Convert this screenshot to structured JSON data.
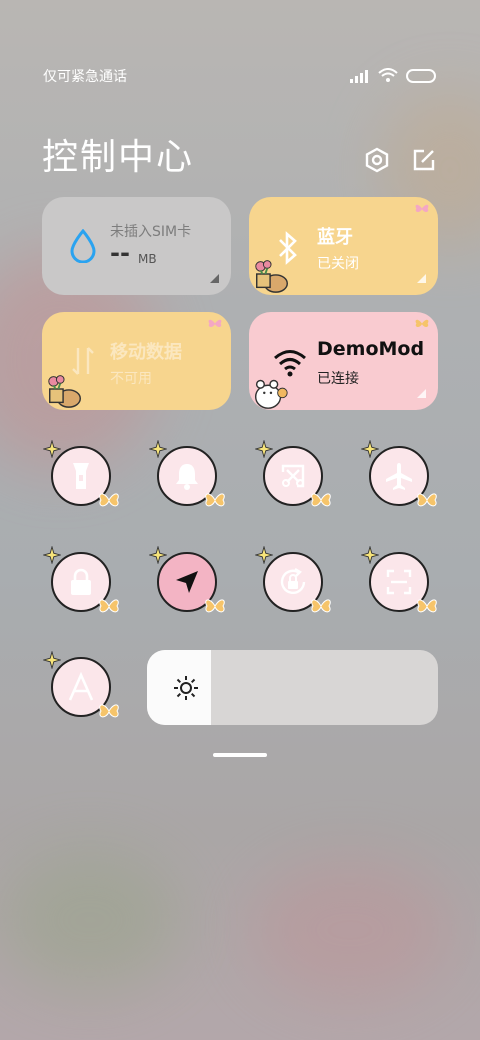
{
  "status_bar": {
    "carrier": "仅可紧急通话",
    "icons": [
      "signal-icon",
      "wifi-icon",
      "battery-icon"
    ]
  },
  "header": {
    "title": "控制中心",
    "buttons": [
      "settings-icon",
      "edit-icon"
    ]
  },
  "tiles": {
    "data_usage": {
      "label": "未插入SIM卡",
      "value": "--",
      "unit": "MB",
      "icon": "water-drop-icon",
      "bg": "#c9c8c8"
    },
    "bluetooth": {
      "label": "蓝牙",
      "status": "已关闭",
      "icon": "bluetooth-icon",
      "bg": "#f7d58e"
    },
    "mobile_data": {
      "label": "移动数据",
      "status": "不可用",
      "icon": "mobile-data-icon",
      "bg": "#f7d58e"
    },
    "wifi": {
      "label": "DemoMod",
      "status": "已连接",
      "icon": "wifi-icon",
      "bg": "#f9cbd0"
    }
  },
  "toggles": [
    {
      "name": "flashlight",
      "icon": "flashlight-icon",
      "active": false
    },
    {
      "name": "silent",
      "icon": "bell-icon",
      "active": false
    },
    {
      "name": "screenshot",
      "icon": "screenshot-icon",
      "active": false
    },
    {
      "name": "airplane",
      "icon": "airplane-icon",
      "active": false
    },
    {
      "name": "lock",
      "icon": "lock-icon",
      "active": false
    },
    {
      "name": "location",
      "icon": "location-icon",
      "active": true
    },
    {
      "name": "rotation-lock",
      "icon": "rotation-lock-icon",
      "active": false
    },
    {
      "name": "scanner",
      "icon": "scanner-icon",
      "active": false
    },
    {
      "name": "auto-brightness",
      "icon": "auto-brightness-icon",
      "active": false
    }
  ],
  "brightness": {
    "level_percent": 22,
    "icon": "brightness-icon"
  },
  "colors": {
    "active_toggle": "#f3b4c4",
    "toggle_bg": "#fbe6ea",
    "yellow_tile": "#f7d58e",
    "pink_tile": "#f9cbd0",
    "gray_tile": "#c9c8c8"
  }
}
